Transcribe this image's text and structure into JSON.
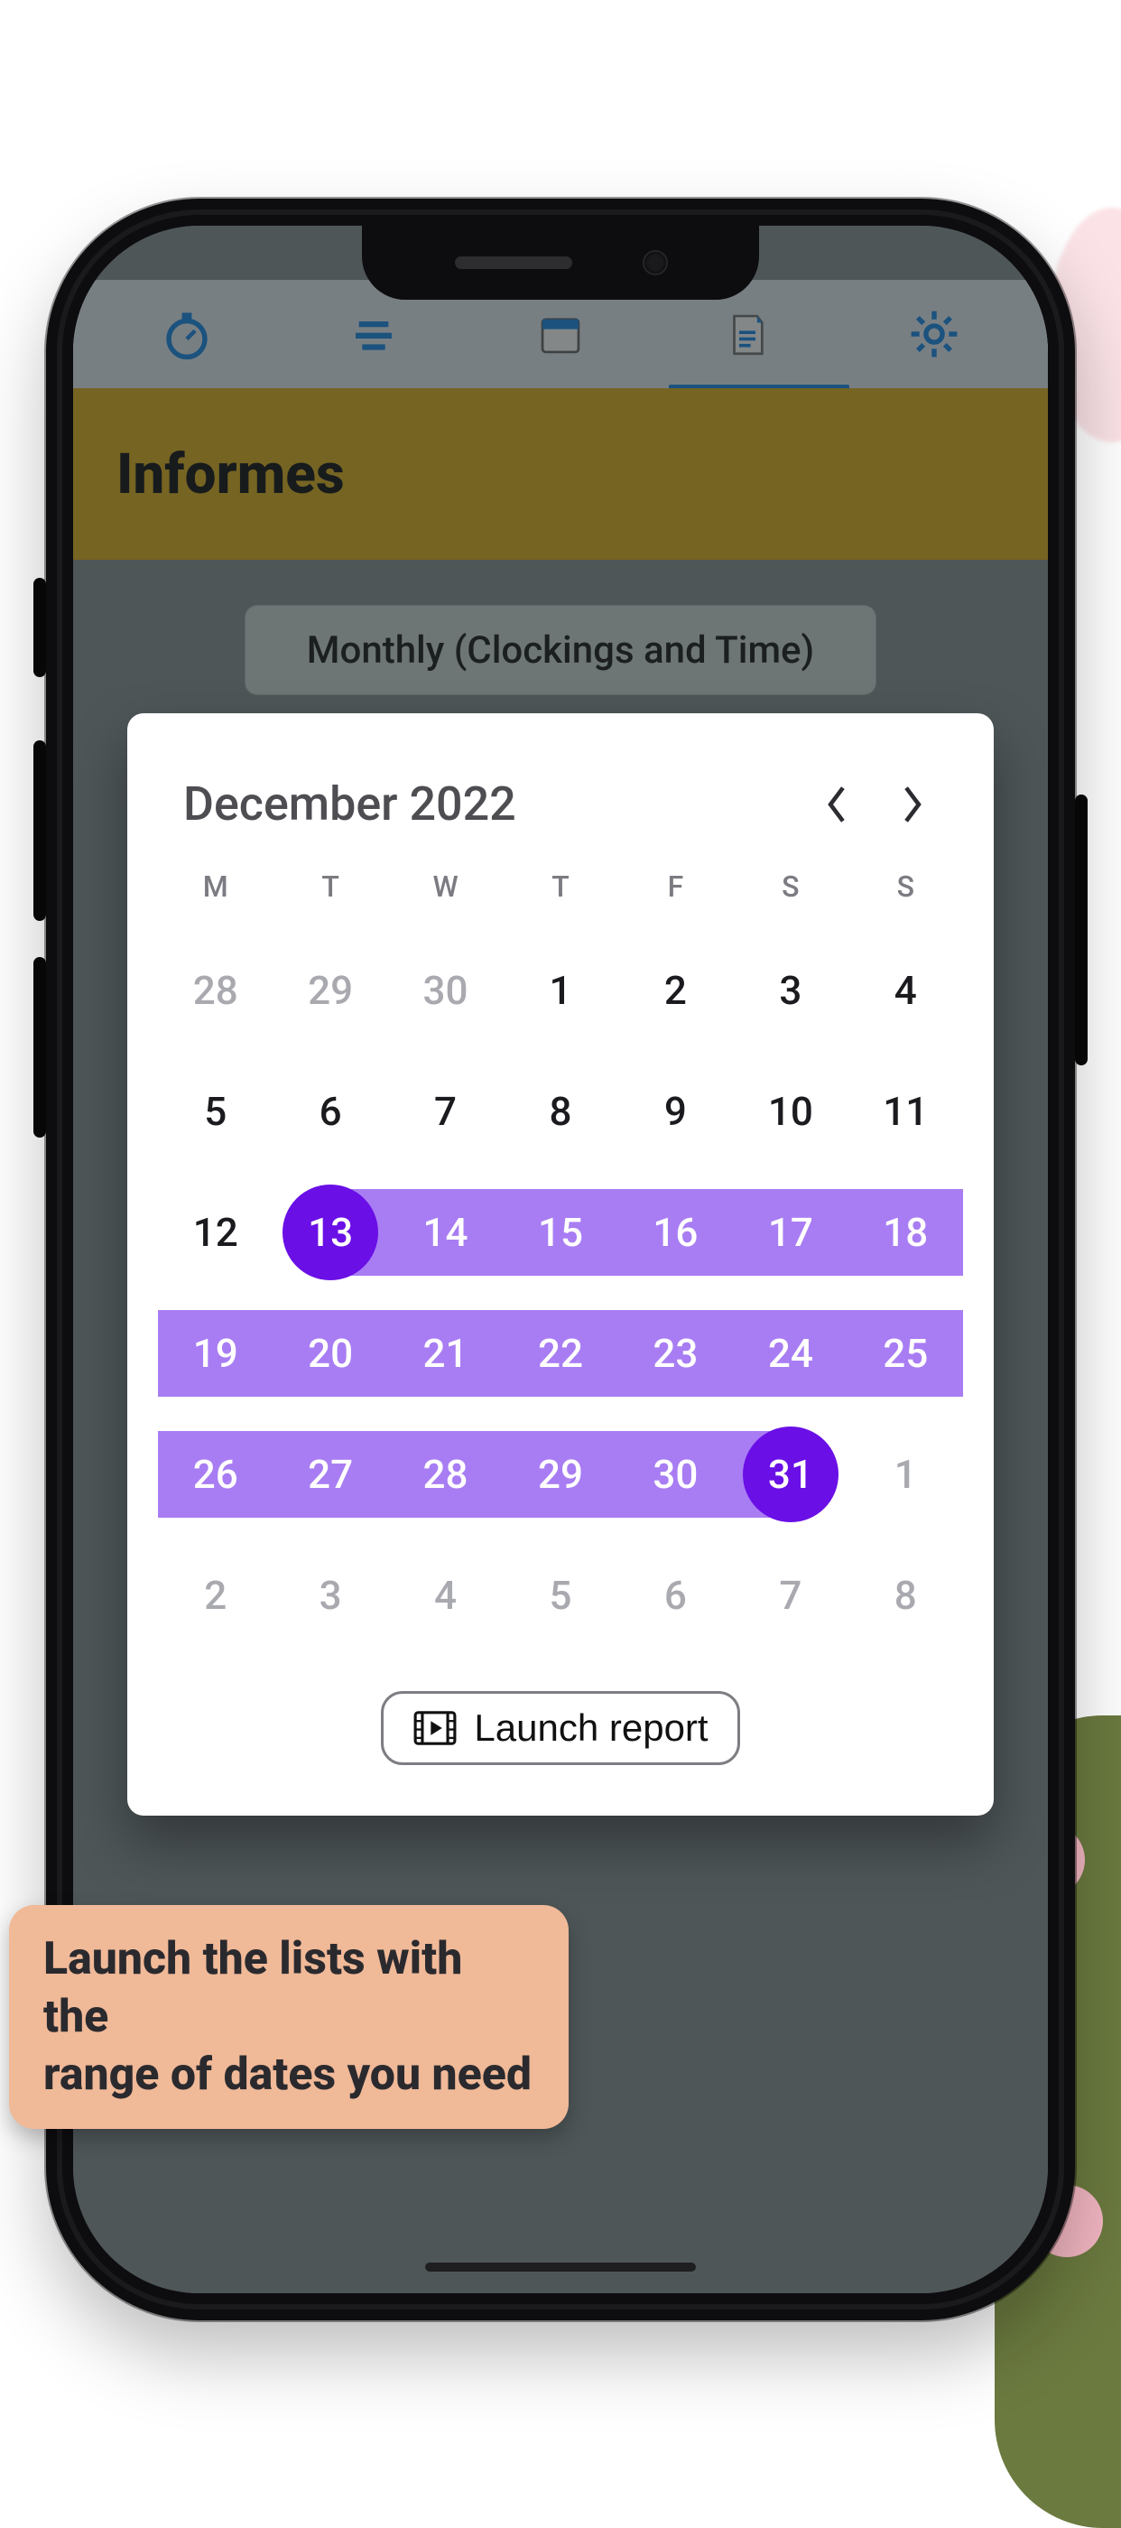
{
  "header": {
    "title": "Informes"
  },
  "mode_button": {
    "label": "Monthly (Clockings and Time)"
  },
  "calendar": {
    "month_label": "December 2022",
    "weekdays": [
      "M",
      "T",
      "W",
      "T",
      "F",
      "S",
      "S"
    ],
    "weeks": [
      [
        {
          "d": "28",
          "out": true
        },
        {
          "d": "29",
          "out": true
        },
        {
          "d": "30",
          "out": true
        },
        {
          "d": "1"
        },
        {
          "d": "2"
        },
        {
          "d": "3"
        },
        {
          "d": "4"
        }
      ],
      [
        {
          "d": "5"
        },
        {
          "d": "6"
        },
        {
          "d": "7"
        },
        {
          "d": "8"
        },
        {
          "d": "9"
        },
        {
          "d": "10"
        },
        {
          "d": "11"
        }
      ],
      [
        {
          "d": "12"
        },
        {
          "d": "13",
          "end": true,
          "in": true
        },
        {
          "d": "14",
          "in": true
        },
        {
          "d": "15",
          "in": true
        },
        {
          "d": "16",
          "in": true
        },
        {
          "d": "17",
          "in": true
        },
        {
          "d": "18",
          "in": true
        }
      ],
      [
        {
          "d": "19",
          "in": true
        },
        {
          "d": "20",
          "in": true
        },
        {
          "d": "21",
          "in": true
        },
        {
          "d": "22",
          "in": true
        },
        {
          "d": "23",
          "in": true
        },
        {
          "d": "24",
          "in": true
        },
        {
          "d": "25",
          "in": true
        }
      ],
      [
        {
          "d": "26",
          "in": true
        },
        {
          "d": "27",
          "in": true
        },
        {
          "d": "28",
          "in": true
        },
        {
          "d": "29",
          "in": true
        },
        {
          "d": "30",
          "in": true
        },
        {
          "d": "31",
          "end": true,
          "in": true
        },
        {
          "d": "1",
          "out": true
        }
      ],
      [
        {
          "d": "2",
          "out": true
        },
        {
          "d": "3",
          "out": true
        },
        {
          "d": "4",
          "out": true
        },
        {
          "d": "5",
          "out": true
        },
        {
          "d": "6",
          "out": true
        },
        {
          "d": "7",
          "out": true
        },
        {
          "d": "8",
          "out": true
        }
      ]
    ],
    "launch_label": "Launch report"
  },
  "tooltip": {
    "line1": "Launch the lists with the",
    "line2": "range of dates you need"
  },
  "colors": {
    "range": "#a87df3",
    "endpoint": "#6a0fe6",
    "header_bg": "#e2b21f",
    "accent": "#1a8be9"
  }
}
